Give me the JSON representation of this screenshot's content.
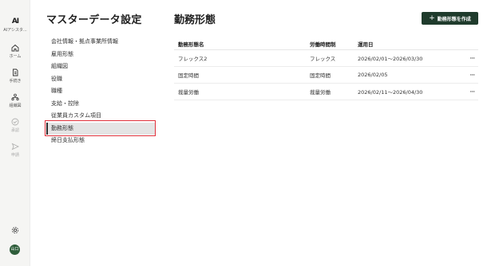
{
  "rail": {
    "logo_glyph": "AI",
    "logo_caption": "AIアシスタ...",
    "items": [
      {
        "label": "ホーム",
        "icon": "home-icon"
      },
      {
        "label": "手続き",
        "icon": "document-icon"
      },
      {
        "label": "組織図",
        "icon": "org-chart-icon"
      },
      {
        "label": "承認",
        "icon": "check-circle-icon"
      },
      {
        "label": "申請",
        "icon": "send-icon"
      }
    ],
    "settings_icon": "gear-icon",
    "avatar_text": "山口"
  },
  "menu": {
    "title": "マスターデータ設定",
    "items": [
      {
        "label": "会社情報・拠点事業所情報"
      },
      {
        "label": "雇用形態"
      },
      {
        "label": "組織図"
      },
      {
        "label": "役職"
      },
      {
        "label": "職種"
      },
      {
        "label": "支給・控除"
      },
      {
        "label": "従業員カスタム項目"
      },
      {
        "label": "勤務形態"
      },
      {
        "label": "締日支払形態"
      }
    ],
    "active_index": 7
  },
  "main": {
    "title": "勤務形態",
    "create_button": "勤務形態を作成",
    "table": {
      "headers": [
        "勤務形態名",
        "労働時間制",
        "運用日",
        ""
      ],
      "rows": [
        {
          "name": "フレックス2",
          "system": "フレックス",
          "period": "2026/02/01〜2026/03/30",
          "more": "···"
        },
        {
          "name": "固定時間",
          "system": "固定時間",
          "period": "2026/02/05",
          "more": "···"
        },
        {
          "name": "裁量労働",
          "system": "裁量労働",
          "period": "2026/02/11〜2026/04/30",
          "more": "···"
        }
      ]
    }
  },
  "colors": {
    "accent": "#1f3b2c",
    "highlight": "#e0303a",
    "rail_bg": "#f5f5f3"
  }
}
